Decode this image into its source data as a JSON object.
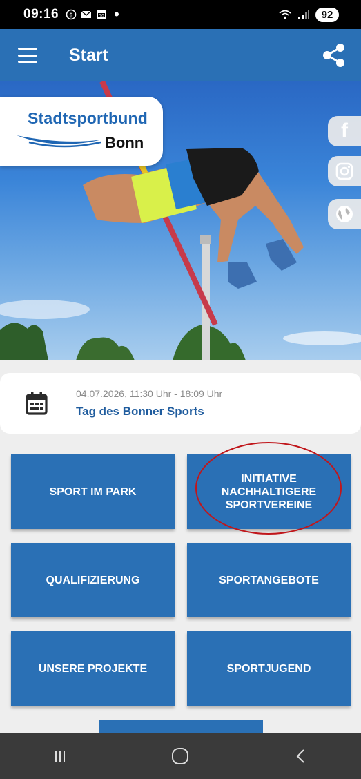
{
  "status_bar": {
    "time": "09:16",
    "battery": "92",
    "icons": [
      "data-saver-icon",
      "mail-icon",
      "calendar-icon",
      "wifi-icon",
      "signal-icon"
    ]
  },
  "app_bar": {
    "title": "Start",
    "menu_icon": "menu-icon",
    "share_icon": "share-icon"
  },
  "hero": {
    "logo": {
      "line1": "Stadtsportbund",
      "line2": "Bonn"
    },
    "social": [
      {
        "name": "facebook",
        "label": "f"
      },
      {
        "name": "instagram"
      },
      {
        "name": "website"
      }
    ]
  },
  "event": {
    "date": "04.07.2026, 11:30 Uhr - 18:09 Uhr",
    "title": "Tag des Bonner Sports"
  },
  "tiles": [
    {
      "label": "SPORT IM PARK"
    },
    {
      "label": "INITIATIVE\nNACHHALTIGERE\nSPORTVEREINE"
    },
    {
      "label": "QUALIFIZIERUNG"
    },
    {
      "label": "SPORTANGEBOTE"
    },
    {
      "label": "UNSERE PROJEKTE"
    },
    {
      "label": "SPORTJUGEND"
    },
    {
      "label": ""
    }
  ],
  "colors": {
    "primary": "#2a70b5",
    "event_title": "#1f5c9e",
    "highlight": "#c0161b",
    "nav_bar": "#3a3a3a"
  }
}
